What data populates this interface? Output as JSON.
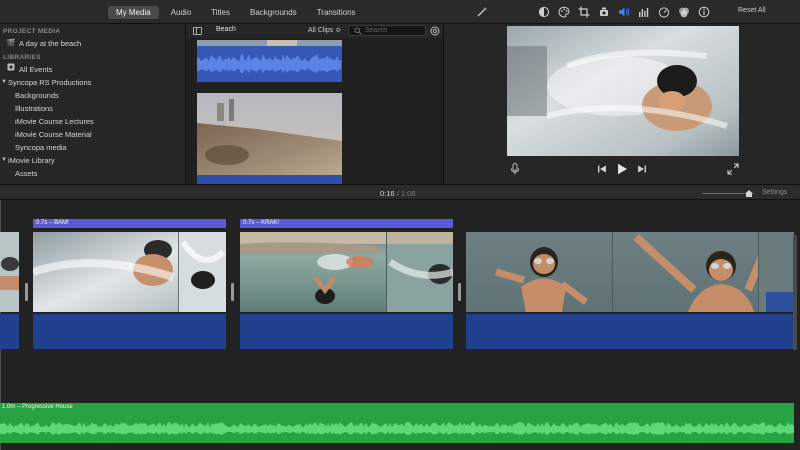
{
  "toolbar": {
    "tabs": [
      {
        "label": "My Media",
        "active": true
      },
      {
        "label": "Audio",
        "active": false
      },
      {
        "label": "Titles",
        "active": false
      },
      {
        "label": "Backgrounds",
        "active": false
      },
      {
        "label": "Transitions",
        "active": false
      }
    ],
    "reset_label": "Reset All",
    "adjust_icons": [
      "color-balance-icon",
      "color-correction-icon",
      "crop-icon",
      "stabilization-icon",
      "volume-icon",
      "noise-reduction-icon",
      "speed-icon",
      "clip-filter-icon",
      "info-icon"
    ]
  },
  "sidebar": {
    "project_heading": "PROJECT MEDIA",
    "project_item": "A day at the beach",
    "libraries_heading": "LIBRARIES",
    "all_events": "All Events",
    "syncopa_library": "Syncopa RS Productions",
    "syncopa_events": [
      "Backgrounds",
      "Illustrations",
      "iMovie Course Lectures",
      "iMovie Course Material",
      "Syncopa media"
    ],
    "imovie_library": "iMovie Library",
    "imovie_events": [
      "Assets"
    ]
  },
  "browser": {
    "event_name": "Beach",
    "clips_filter": "All Clips ≎",
    "search_placeholder": "Search"
  },
  "timeline": {
    "current_time": "0:16",
    "separator": "/",
    "total_time": "1:08",
    "settings_label": "Settings",
    "title_clips": [
      {
        "label": "0.7s – BAM!"
      },
      {
        "label": "0.7s – KRAK!"
      }
    ],
    "music_label": "1.0m – Progressive House"
  },
  "colors": {
    "title_bar": "#5b5bd6",
    "audio_track": "#21418e",
    "music_track": "#27a341",
    "accent_blue": "#3a84ff"
  }
}
